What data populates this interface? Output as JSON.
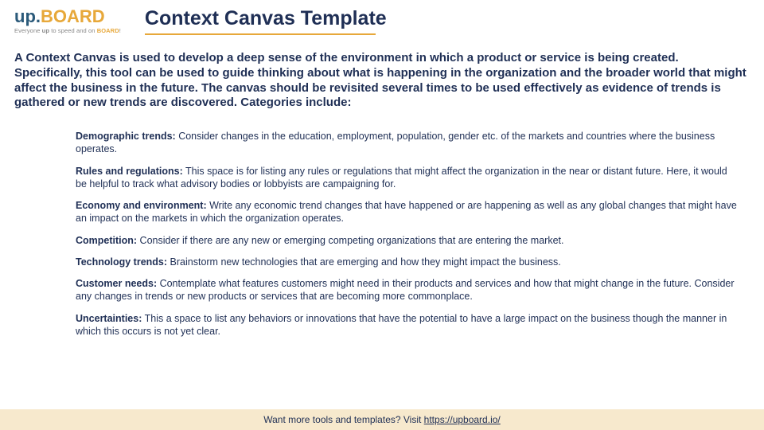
{
  "logo": {
    "up": "up",
    "dot": ".",
    "board": "BOARD",
    "tagline_pre": "Everyone ",
    "tagline_up": "up",
    "tagline_mid": " to speed and on ",
    "tagline_board": "BOARD",
    "tagline_end": "!"
  },
  "title": "Context Canvas Template",
  "intro": "A Context Canvas is used to develop a deep sense of the environment in which a product or service is being created. Specifically, this tool can be used to guide thinking about what is happening in the organization and the broader world that might affect the business in the future. The canvas should be revisited several times to be used effectively as evidence of trends is gathered or new trends are discovered. Categories include:",
  "categories": [
    {
      "label": "Demographic trends:",
      "text": " Consider changes in the education, employment, population, gender etc. of the markets and countries where the business operates."
    },
    {
      "label": "Rules and regulations:",
      "text": " This space is for listing any rules or regulations that might affect the organization in the near or distant future. Here, it would be helpful to track what advisory bodies or lobbyists are campaigning for."
    },
    {
      "label": "Economy and environment:",
      "text": " Write any economic trend changes that have happened or are happening as well as any global changes that might have an impact on the markets in which the organization operates."
    },
    {
      "label": "Competition:",
      "text": " Consider if there are any new or emerging competing organizations that are entering the market."
    },
    {
      "label": "Technology trends:",
      "text": " Brainstorm new technologies that are emerging and how they might impact the business."
    },
    {
      "label": "Customer needs:",
      "text": " Contemplate what features customers might need in their products and services and how that might change in the future. Consider any changes in trends or new products or services that are becoming more commonplace."
    },
    {
      "label": "Uncertainties:",
      "text": " This a space to list any behaviors or innovations that have the potential to have a large impact on the business though the manner in which this occurs is not yet clear."
    }
  ],
  "footer": {
    "text": "Want more tools and templates? Visit ",
    "link_text": "https://upboard.io/",
    "link_href": "https://upboard.io/"
  }
}
